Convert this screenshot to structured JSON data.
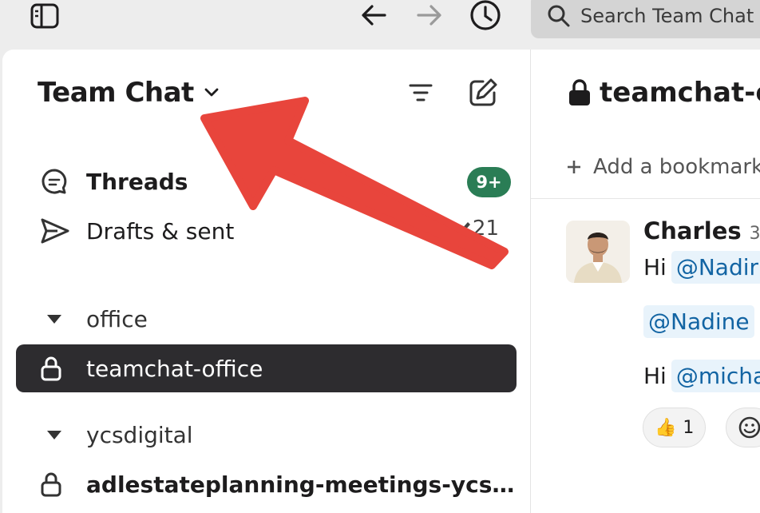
{
  "topbar": {
    "search_placeholder": "Search Team Chat"
  },
  "sidebar": {
    "workspace_name": "Team Chat",
    "nav": [
      {
        "label": "Threads",
        "badge": "9+"
      },
      {
        "label": "Drafts & sent",
        "count": "21"
      }
    ],
    "sections": [
      {
        "name": "office",
        "channels": [
          {
            "name": "teamchat-office",
            "active": true,
            "private": true
          }
        ]
      },
      {
        "name": "ycsdigital",
        "channels": [
          {
            "name": "adlestateplanning-meetings-ycs…",
            "unread": true,
            "private": true
          }
        ]
      }
    ]
  },
  "channel": {
    "title": "teamchat-o",
    "bookmark_label": "Add a bookmark",
    "message": {
      "author": "Charles",
      "time": "3:",
      "lines": [
        {
          "prefix": "Hi",
          "mention": "@Nadir"
        },
        {
          "prefix": "",
          "mention": "@Nadine"
        },
        {
          "prefix": "Hi",
          "mention": "@micha"
        }
      ],
      "reactions": [
        {
          "emoji": "👍",
          "count": "1"
        }
      ]
    }
  },
  "colors": {
    "active_row": "#2d2c2f",
    "badge": "#2a7d55",
    "mention_text": "#1264a3",
    "annotation_arrow": "#e8453c"
  }
}
